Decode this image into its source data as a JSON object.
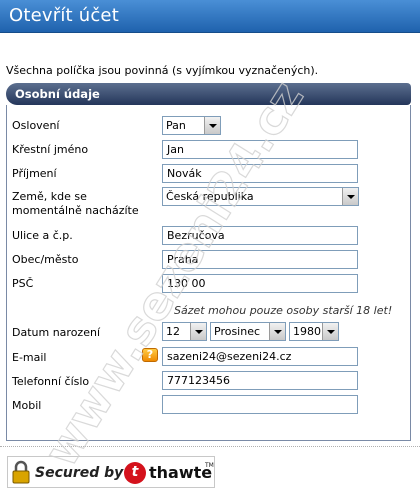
{
  "header": {
    "title": "Otevřít účet"
  },
  "intro_text": "Všechna políčka jsou povinná (s vyjímkou vyznačených).",
  "section": {
    "title": "Osobní údaje"
  },
  "form": {
    "salutation": {
      "label": "Oslovení",
      "value": "Pan"
    },
    "first_name": {
      "label": "Křestní jméno",
      "value": "Jan"
    },
    "last_name": {
      "label": "Příjmení",
      "value": "Novák"
    },
    "country": {
      "label_line1": "Země, kde se",
      "label_line2": "momentálně nacházíte",
      "value": "Česká republika"
    },
    "street": {
      "label": "Ulice a č.p.",
      "value": "Bezručova"
    },
    "city": {
      "label": "Obec/město",
      "value": "Praha"
    },
    "zip": {
      "label": "PSČ",
      "value": "130 00"
    },
    "age_note": "Sázet mohou pouze osoby starší 18 let!",
    "birth_date": {
      "label": "Datum narození",
      "day": "12",
      "month": "Prosinec",
      "year": "1980"
    },
    "email": {
      "label": "E-mail",
      "value": "sazeni24@sezeni24.cz"
    },
    "phone": {
      "label": "Telefonní číslo",
      "value": "777123456"
    },
    "mobile": {
      "label": "Mobil",
      "value": ""
    }
  },
  "help_icon": {
    "glyph": "?"
  },
  "security_badge": {
    "secured_text": "Secured by",
    "brand": "thawte",
    "logo_letter": "t",
    "trademark": "TM"
  },
  "watermark": {
    "text": "www.sezeni24.cz"
  },
  "colors": {
    "header": "#1f62ad",
    "section_bar": "#24365a",
    "help_icon": "#f08a00",
    "thawte_red": "#d4121c"
  }
}
